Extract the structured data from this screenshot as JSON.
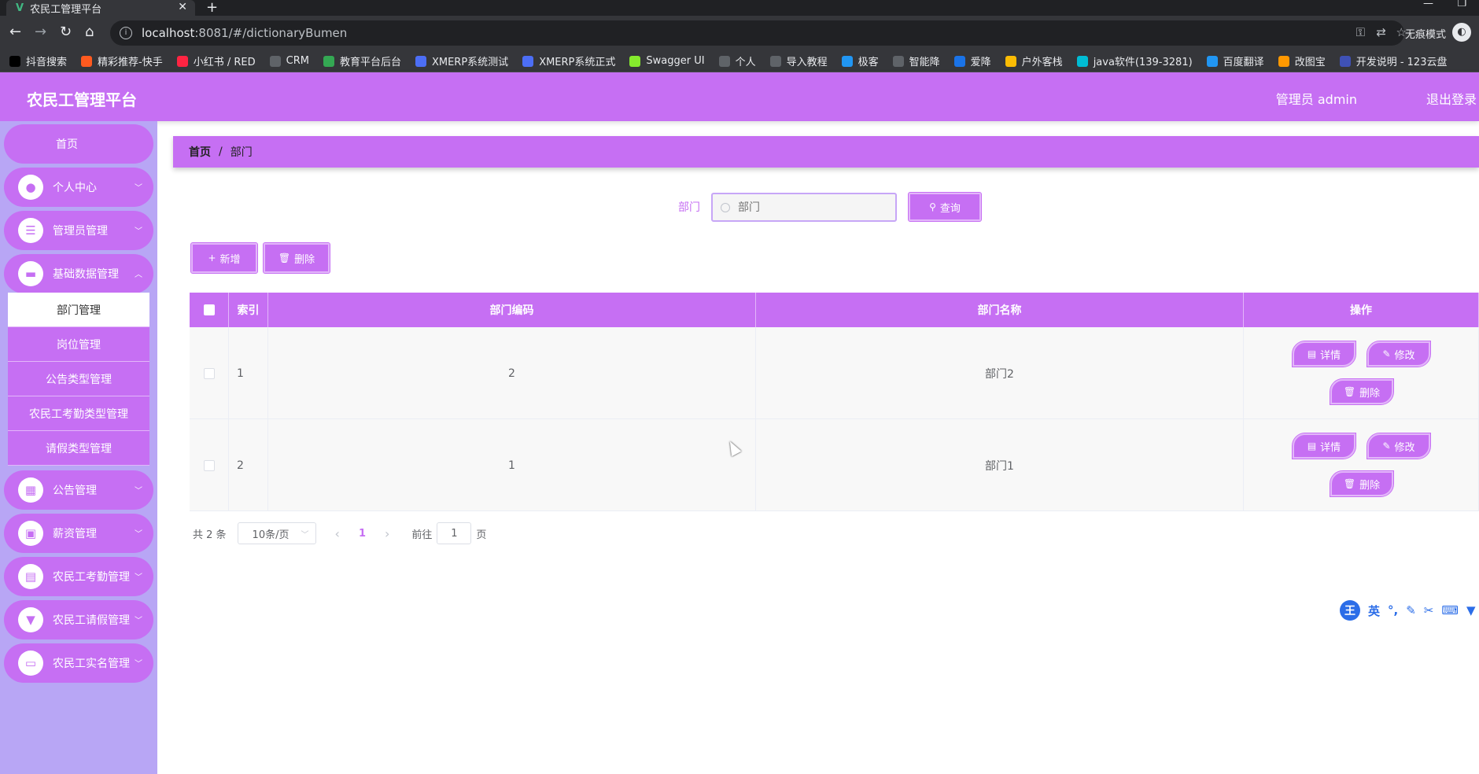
{
  "browser": {
    "tab_title": "农民工管理平台",
    "url_host": "localhost",
    "url_rest": ":8081/#/dictionaryBumen",
    "incognito_label": "无痕模式",
    "bookmarks": [
      {
        "label": "抖音搜索",
        "color": "#000000"
      },
      {
        "label": "精彩推荐-快手",
        "color": "#ff5a1f"
      },
      {
        "label": "小红书 / RED",
        "color": "#ff2442"
      },
      {
        "label": "CRM",
        "color": "#5f6368"
      },
      {
        "label": "教育平台后台",
        "color": "#34a853"
      },
      {
        "label": "XMERP系统测试",
        "color": "#4c6ef5"
      },
      {
        "label": "XMERP系统正式",
        "color": "#4c6ef5"
      },
      {
        "label": "Swagger UI",
        "color": "#85ea2d"
      },
      {
        "label": "个人",
        "color": "#5f6368"
      },
      {
        "label": "导入教程",
        "color": "#5f6368"
      },
      {
        "label": "极客",
        "color": "#2196f3"
      },
      {
        "label": "智能降",
        "color": "#5f6368"
      },
      {
        "label": "爱降",
        "color": "#1a73e8"
      },
      {
        "label": "户外客栈",
        "color": "#fbbc04"
      },
      {
        "label": "java软件(139-3281)",
        "color": "#00bcd4"
      },
      {
        "label": "百度翻译",
        "color": "#2196f3"
      },
      {
        "label": "改图宝",
        "color": "#ff9800"
      },
      {
        "label": "开发说明 - 123云盘",
        "color": "#3f51b5"
      }
    ]
  },
  "header": {
    "title": "农民工管理平台",
    "admin_label": "管理员 admin",
    "logout_label": "退出登录"
  },
  "sidebar": {
    "home": "首页",
    "menus": [
      {
        "label": "个人中心",
        "icon": "user-icon"
      },
      {
        "label": "管理员管理",
        "icon": "sliders-icon"
      },
      {
        "label": "基础数据管理",
        "icon": "ticket-icon"
      },
      {
        "label": "公告管理",
        "icon": "grid-icon"
      },
      {
        "label": "薪资管理",
        "icon": "briefcase-icon"
      },
      {
        "label": "农民工考勤管理",
        "icon": "clipboard-icon"
      },
      {
        "label": "农民工请假管理",
        "icon": "pin-icon"
      },
      {
        "label": "农民工实名管理",
        "icon": "monitor-icon"
      }
    ],
    "submenu": [
      {
        "label": "部门管理",
        "active": true
      },
      {
        "label": "岗位管理",
        "active": false
      },
      {
        "label": "公告类型管理",
        "active": false
      },
      {
        "label": "农民工考勤类型管理",
        "active": false
      },
      {
        "label": "请假类型管理",
        "active": false
      }
    ]
  },
  "breadcrumb": {
    "home": "首页",
    "sep": "/",
    "current": "部门"
  },
  "search": {
    "label": "部门",
    "placeholder": "部门",
    "query_button": "查询"
  },
  "toolbar": {
    "add": "新增",
    "delete": "删除"
  },
  "table": {
    "columns": [
      "索引",
      "部门编码",
      "部门名称",
      "操作"
    ],
    "rows": [
      {
        "index": "1",
        "code": "2",
        "name": "部门2"
      },
      {
        "index": "2",
        "code": "1",
        "name": "部门1"
      }
    ],
    "actions": {
      "detail": "详情",
      "edit": "修改",
      "delete": "删除"
    }
  },
  "pagination": {
    "total": "共 2 条",
    "page_size": "10条/页",
    "current_page": "1",
    "goto_label": "前往",
    "goto_value": "1",
    "page_suffix": "页"
  },
  "ime": {
    "logo": "王",
    "mode": "英"
  },
  "colors": {
    "primary": "#c66ff3",
    "sidebar_bg": "#b8a6f5",
    "border_light": "#e3b6fa"
  }
}
